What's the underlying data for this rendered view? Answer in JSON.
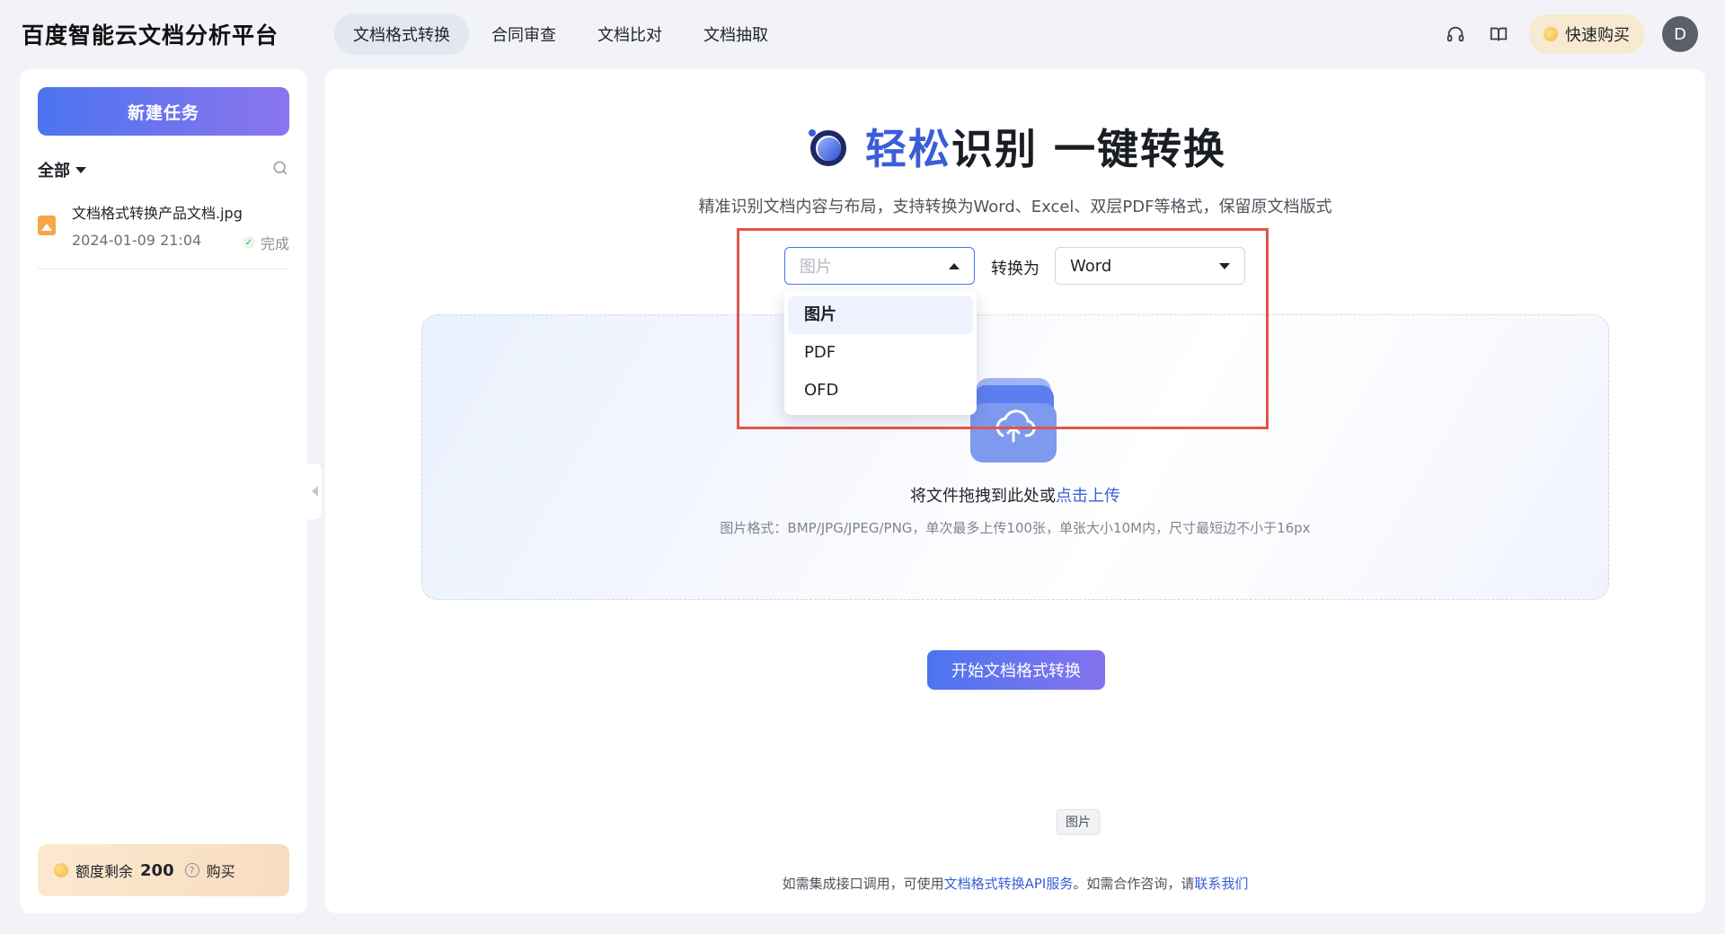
{
  "header": {
    "logo": "百度智能云文档分析平台",
    "nav": [
      {
        "label": "文档格式转换",
        "active": true
      },
      {
        "label": "合同审查",
        "active": false
      },
      {
        "label": "文档比对",
        "active": false
      },
      {
        "label": "文档抽取",
        "active": false
      }
    ],
    "icons": [
      "headset-icon",
      "book-icon"
    ],
    "buy_label": "快速购买",
    "avatar_letter": "D"
  },
  "sidebar": {
    "new_task_label": "新建任务",
    "filter_label": "全部",
    "tasks": [
      {
        "name": "文档格式转换产品文档.jpg",
        "date": "2024-01-09 21:04",
        "status": "完成"
      }
    ],
    "quota": {
      "label": "额度剩余",
      "value": "200",
      "buy_label": "购买"
    }
  },
  "main": {
    "title_accent": "轻松",
    "title_rest": "识别 一键转换",
    "subtitle": "精准识别文档内容与布局，支持转换为Word、Excel、双层PDF等格式，保留原文档版式",
    "source_select": {
      "placeholder": "图片",
      "options": [
        "图片",
        "PDF",
        "OFD"
      ],
      "selected": "图片"
    },
    "convert_label": "转换为",
    "target_select": {
      "value": "Word"
    },
    "upload": {
      "text": "将文件拖拽到此处或",
      "link": "点击上传",
      "hint": "图片格式：BMP/JPG/JPEG/PNG，单次最多上传100张，单张大小10M内，尺寸最短边不小于16px"
    },
    "start_button": "开始文档格式转换",
    "tooltip": "图片",
    "footer": {
      "pre": "如需集成接口调用，可使用",
      "api_link": "文档格式转换API服务",
      "mid": "。如需合作咨询，请",
      "contact_link": "联系我们"
    }
  },
  "colors": {
    "accent": "#3a5ed8",
    "highlight_box": "#e0554a",
    "buy_bg": "#f8ead1"
  }
}
